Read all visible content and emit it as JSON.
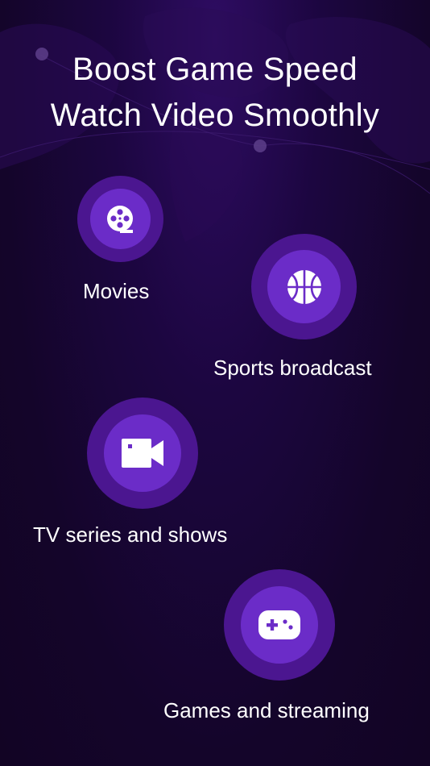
{
  "headline": {
    "line1": "Boost Game Speed",
    "line2": "Watch Video Smoothly"
  },
  "features": [
    {
      "label": "Movies",
      "icon": "film-reel-icon"
    },
    {
      "label": "Sports broadcast",
      "icon": "basketball-icon"
    },
    {
      "label": "TV series and shows",
      "icon": "video-camera-icon"
    },
    {
      "label": "Games and streaming",
      "icon": "gamepad-icon"
    }
  ],
  "colors": {
    "background": "#15052a",
    "circle_outer": "#4b1690",
    "circle_inner": "#6b2cc8",
    "text": "#ffffff"
  }
}
